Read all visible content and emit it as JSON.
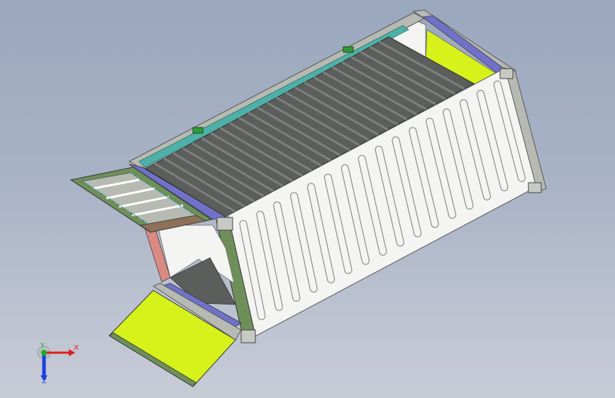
{
  "viewport": {
    "background_top": "#9aa7bd",
    "background_bottom": "#c8ccd7"
  },
  "model": {
    "panel_white": "#f4f4f2",
    "floor_dark": "#5b5e5b",
    "accent_yellow_green": "#d7f21a",
    "frame_green": "#6f8f5a",
    "frame_teal": "#4fb0a8",
    "frame_blue": "#6f72c8",
    "frame_red": "#d98a82",
    "frame_gray": "#b7bab3"
  },
  "triad": {
    "x_label": "X",
    "y_label": "Y",
    "z_label": "Z",
    "x_color": "#e01b1b",
    "y_color": "#1bb01b",
    "z_color": "#1b3fe0"
  }
}
